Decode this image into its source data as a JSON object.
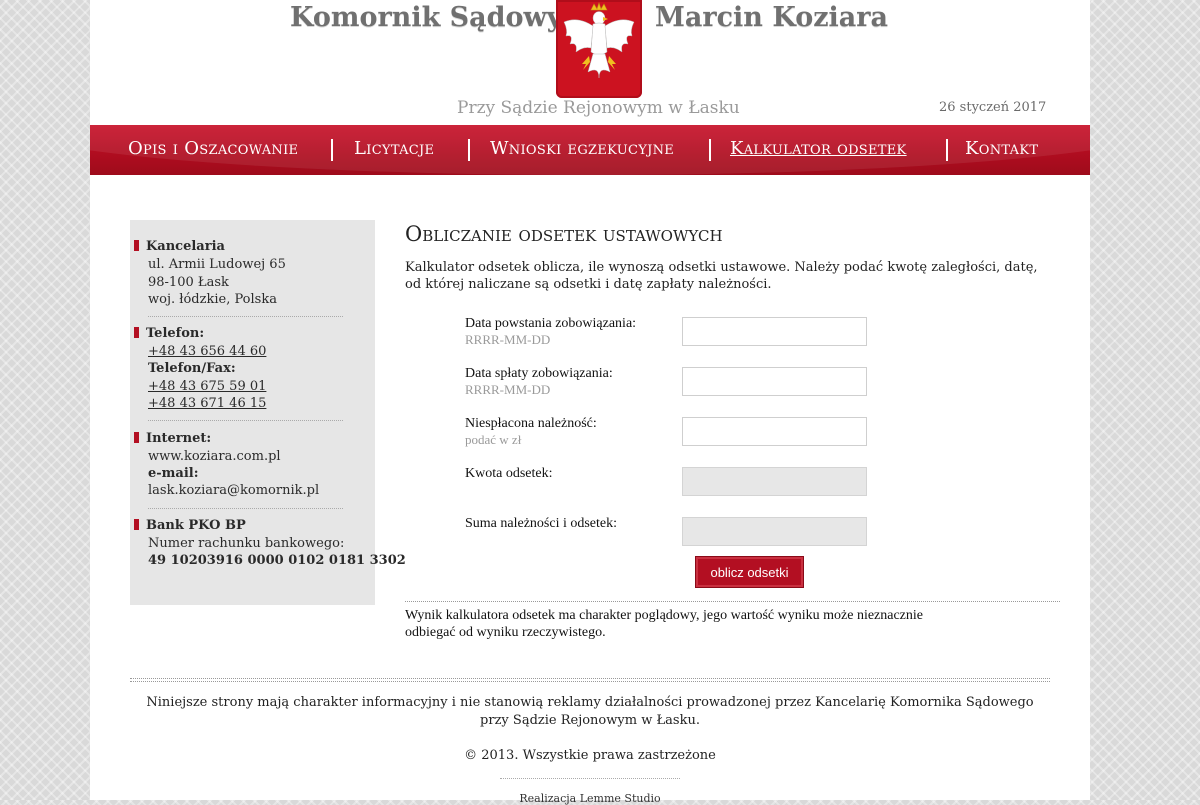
{
  "header": {
    "title_left": "Komornik Sądowy",
    "title_right": "Marcin Koziara",
    "subtitle": "Przy Sądzie Rejonowym w Łasku",
    "date": "26 styczeń 2017",
    "emblem_icon": "polish-eagle-emblem",
    "accent_color": "#b30f22"
  },
  "nav": {
    "items": [
      {
        "label": "Opis i Oszacowanie"
      },
      {
        "label": "Licytacje"
      },
      {
        "label": "Wnioski egzekucyjne"
      },
      {
        "label": "Kalkulator odsetek",
        "active": true
      },
      {
        "label": "Kontakt"
      }
    ]
  },
  "sidebar": {
    "office_heading": "Kancelaria",
    "address_lines": [
      "ul. Armii Ludowej 65",
      "98-100 Łask",
      "woj. łódzkie, Polska"
    ],
    "phone_heading": "Telefon:",
    "phone": "+48 43 656 44 60",
    "fax_heading": "Telefon/Fax:",
    "fax_1": "+48 43 675 59 01",
    "fax_2": "+48 43 671 46 15",
    "internet_heading": "Internet:",
    "website": "www.koziara.com.pl",
    "email_heading": "e-mail:",
    "email": "lask.koziara@komornik.pl",
    "bank_heading": "Bank PKO BP",
    "account_label": "Numer rachunku bankowego:",
    "account_number": "49 10203916 0000 0102 0181 3302"
  },
  "main": {
    "title": "Obliczanie odsetek ustawowych",
    "intro": "Kalkulator odsetek oblicza, ile wynoszą odsetki ustawowe. Należy podać kwotę zaległości, datę, od której naliczane są odsetki i datę zapłaty należności.",
    "form": {
      "start_date_label": "Data powstania zobowiązania:",
      "start_date_hint": "RRRR-MM-DD",
      "start_date_value": "",
      "payment_date_label": "Data spłaty zobowiązania:",
      "payment_date_hint": "RRRR-MM-DD",
      "payment_date_value": "",
      "amount_label": "Niespłacona należność:",
      "amount_hint": "podać w zł",
      "amount_value": "",
      "interest_label": "Kwota odsetek:",
      "interest_value": "",
      "total_label": "Suma należności i odsetek:",
      "total_value": "",
      "submit_label": "oblicz odsetki"
    },
    "note": "Wynik kalkulatora odsetek ma charakter poglądowy, jego wartość wyniku może nieznacznie odbiegać od wyniku rzeczywistego."
  },
  "footer": {
    "disclaimer_line1": "Niniejsze strony mają charakter informacyjny i nie stanowią reklamy działalności prowadzonej przez Kancelarię Komornika Sądowego",
    "disclaimer_line2": "przy Sądzie Rejonowym w Łasku.",
    "copyright": "© 2013. Wszystkie prawa zastrzeżone",
    "credits": "Realizacja Lemme Studio"
  }
}
